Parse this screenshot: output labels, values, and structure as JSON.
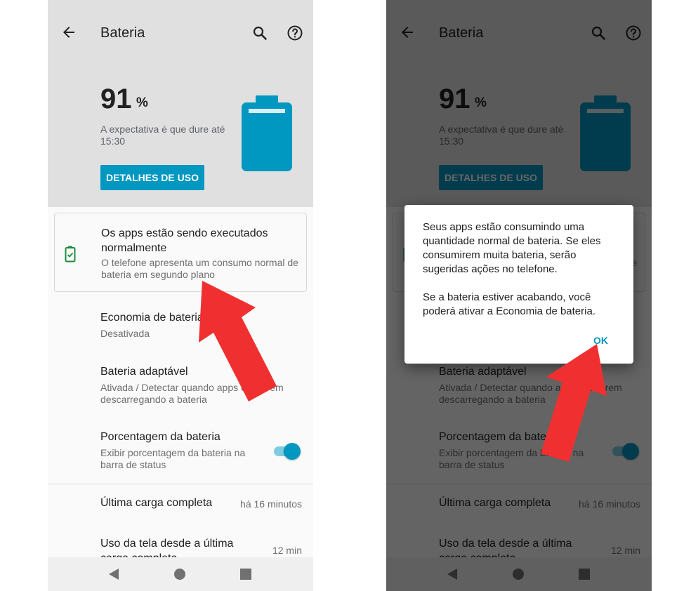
{
  "header": {
    "title": "Bateria",
    "battery_value": "91",
    "battery_unit": "%",
    "expectation": "A expectativa é que dure até 15:30",
    "details_button": "DETALHES DE USO"
  },
  "status_card": {
    "title": "Os apps estão sendo executados normalmente",
    "description": "O telefone apresenta um consumo normal de bateria em segundo plano"
  },
  "settings": {
    "economy_title": "Economia de bateria",
    "economy_sub": "Desativada",
    "adaptive_title": "Bateria adaptável",
    "adaptive_sub": "Ativada / Detectar quando apps estiverem descarregando a bateria",
    "percentage_title": "Porcentagem da bateria",
    "percentage_sub": "Exibir porcentagem da bateria na barra de status",
    "percentage_toggle_on": true
  },
  "stats": {
    "last_charge_label": "Última carga completa",
    "last_charge_value": "há 16 minutos",
    "screen_usage_label": "Uso da tela desde a última carga completa",
    "screen_usage_value": "12 min"
  },
  "dialog": {
    "paragraph1": "Seus apps estão consumindo uma quantidade normal de bateria. Se eles consumirem muita bateria, serão sugeridas ações no telefone.",
    "paragraph2": "Se a bateria estiver acabando, você poderá ativar a Economia de bateria.",
    "ok": "OK"
  },
  "icons": {
    "back": "arrow-back-icon",
    "search": "search-icon",
    "help": "help-circle-icon",
    "battery": "battery-icon",
    "battery_ok": "battery-check-icon"
  },
  "colors": {
    "accent": "#0097c1",
    "header_bg": "#e0e0e0",
    "battery_ok_green": "#1e8e3e",
    "annotation_arrow": "#f03030"
  }
}
